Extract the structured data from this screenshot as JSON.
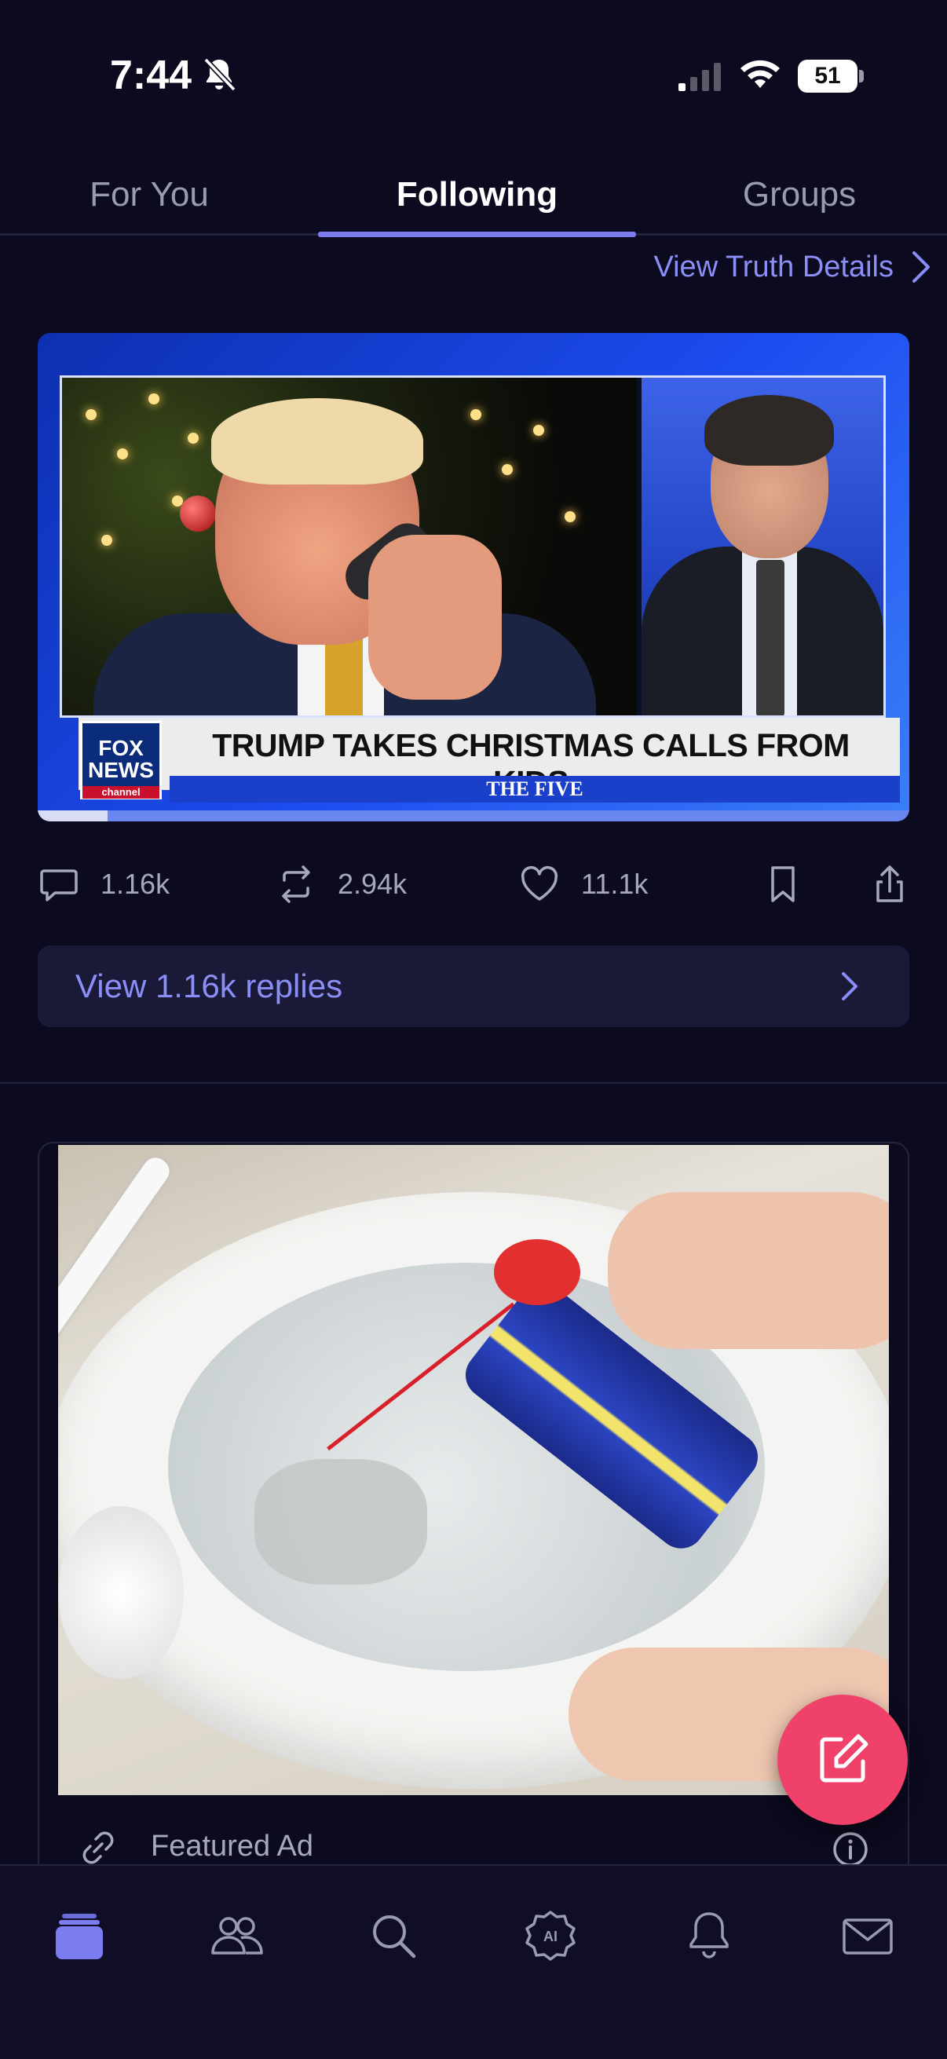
{
  "status_bar": {
    "time": "7:44",
    "battery_level": "51",
    "icons": [
      "bell-muted-icon",
      "cellular-signal-icon",
      "wifi-icon",
      "battery-icon"
    ]
  },
  "tabs": [
    {
      "label": "For You",
      "active": false
    },
    {
      "label": "Following",
      "active": true
    },
    {
      "label": "Groups",
      "active": false
    }
  ],
  "post": {
    "view_details_label": "View Truth Details",
    "media": {
      "network_logo": "FOX NEWS",
      "network_logo_sub": "channel",
      "chyron": "TRUMP TAKES CHRISTMAS CALLS FROM KIDS",
      "chyron_sub": "THE FIVE",
      "video_progress": 0.08
    },
    "stats": {
      "replies": "1.16k",
      "retruths": "2.94k",
      "likes": "11.1k"
    },
    "view_replies_label": "View 1.16k replies"
  },
  "ad": {
    "label": "Featured Ad"
  },
  "bottom_nav": [
    {
      "icon": "home-feed-icon",
      "active": true
    },
    {
      "icon": "people-icon",
      "active": false
    },
    {
      "icon": "search-icon",
      "active": false
    },
    {
      "icon": "ai-badge-icon",
      "active": false
    },
    {
      "icon": "bell-icon",
      "active": false
    },
    {
      "icon": "mail-icon",
      "active": false
    }
  ],
  "colors": {
    "background": "#0b0a1f",
    "accent": "#7a7cf0",
    "link": "#8c8ef8",
    "fab": "#f0416a",
    "muted_text": "#a8a8bc"
  }
}
